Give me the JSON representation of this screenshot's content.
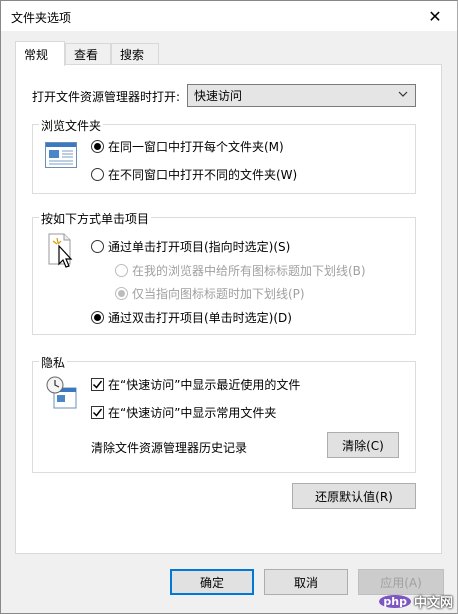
{
  "window": {
    "title": "文件夹选项",
    "close_glyph": "✕"
  },
  "tabs": [
    {
      "label": "常规",
      "active": true
    },
    {
      "label": "查看",
      "active": false
    },
    {
      "label": "搜索",
      "active": false
    }
  ],
  "open_explorer": {
    "label": "打开文件资源管理器时打开:",
    "value": "快速访问"
  },
  "browse_folders": {
    "title": "浏览文件夹",
    "options": [
      {
        "label": "在同一窗口中打开每个文件夹(M)",
        "selected": true
      },
      {
        "label": "在不同窗口中打开不同的文件夹(W)",
        "selected": false
      }
    ]
  },
  "click_items": {
    "title": "按如下方式单击项目",
    "single_click": {
      "label": "通过单击打开项目(指向时选定)(S)",
      "selected": false
    },
    "underline_all": {
      "label": "在我的浏览器中给所有图标标题加下划线(B)",
      "selected": false,
      "disabled": true
    },
    "underline_point": {
      "label": "仅当指向图标标题时加下划线(P)",
      "selected": true,
      "disabled": true
    },
    "double_click": {
      "label": "通过双击打开项目(单击时选定)(D)",
      "selected": true
    }
  },
  "privacy": {
    "title": "隐私",
    "show_recent_files": {
      "label": "在“快速访问”中显示最近使用的文件",
      "checked": true
    },
    "show_frequent_folders": {
      "label": "在“快速访问”中显示常用文件夹",
      "checked": true
    },
    "clear_history_label": "清除文件资源管理器历史记录",
    "clear_button": "清除(C)"
  },
  "restore_defaults": "还原默认值(R)",
  "footer": {
    "ok": "确定",
    "cancel": "取消",
    "apply": "应用(A)"
  },
  "watermark": {
    "logo": "php",
    "text": "中文网"
  }
}
